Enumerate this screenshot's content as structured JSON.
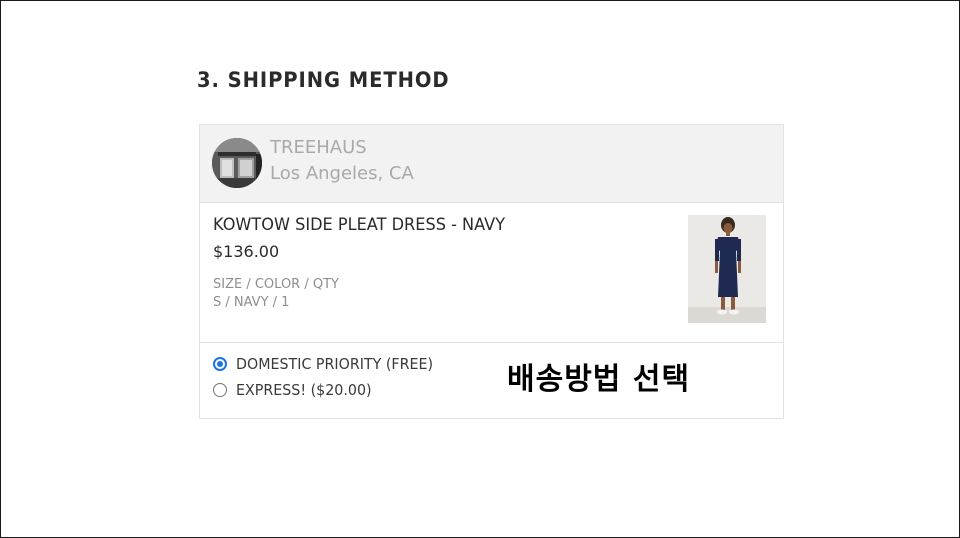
{
  "section": {
    "title": "3. SHIPPING METHOD"
  },
  "store": {
    "name": "TREEHAUS",
    "location": "Los Angeles, CA",
    "avatar_icon": "storefront-photo"
  },
  "product": {
    "name": "KOWTOW SIDE PLEAT DRESS - NAVY",
    "price": "$136.00",
    "attributes_label": "SIZE / COLOR / QTY",
    "attributes_value": "S / NAVY / 1",
    "image_icon": "dress-photo"
  },
  "shipping": {
    "options": [
      {
        "label": "DOMESTIC PRIORITY (FREE)",
        "selected": true
      },
      {
        "label": "EXPRESS! ($20.00)",
        "selected": false
      }
    ]
  },
  "annotation": {
    "text": "배송방법 선택"
  },
  "colors": {
    "accent_radio": "#1a73e8",
    "border": "#e3e3e3",
    "header_bg": "#f2f2f2"
  }
}
